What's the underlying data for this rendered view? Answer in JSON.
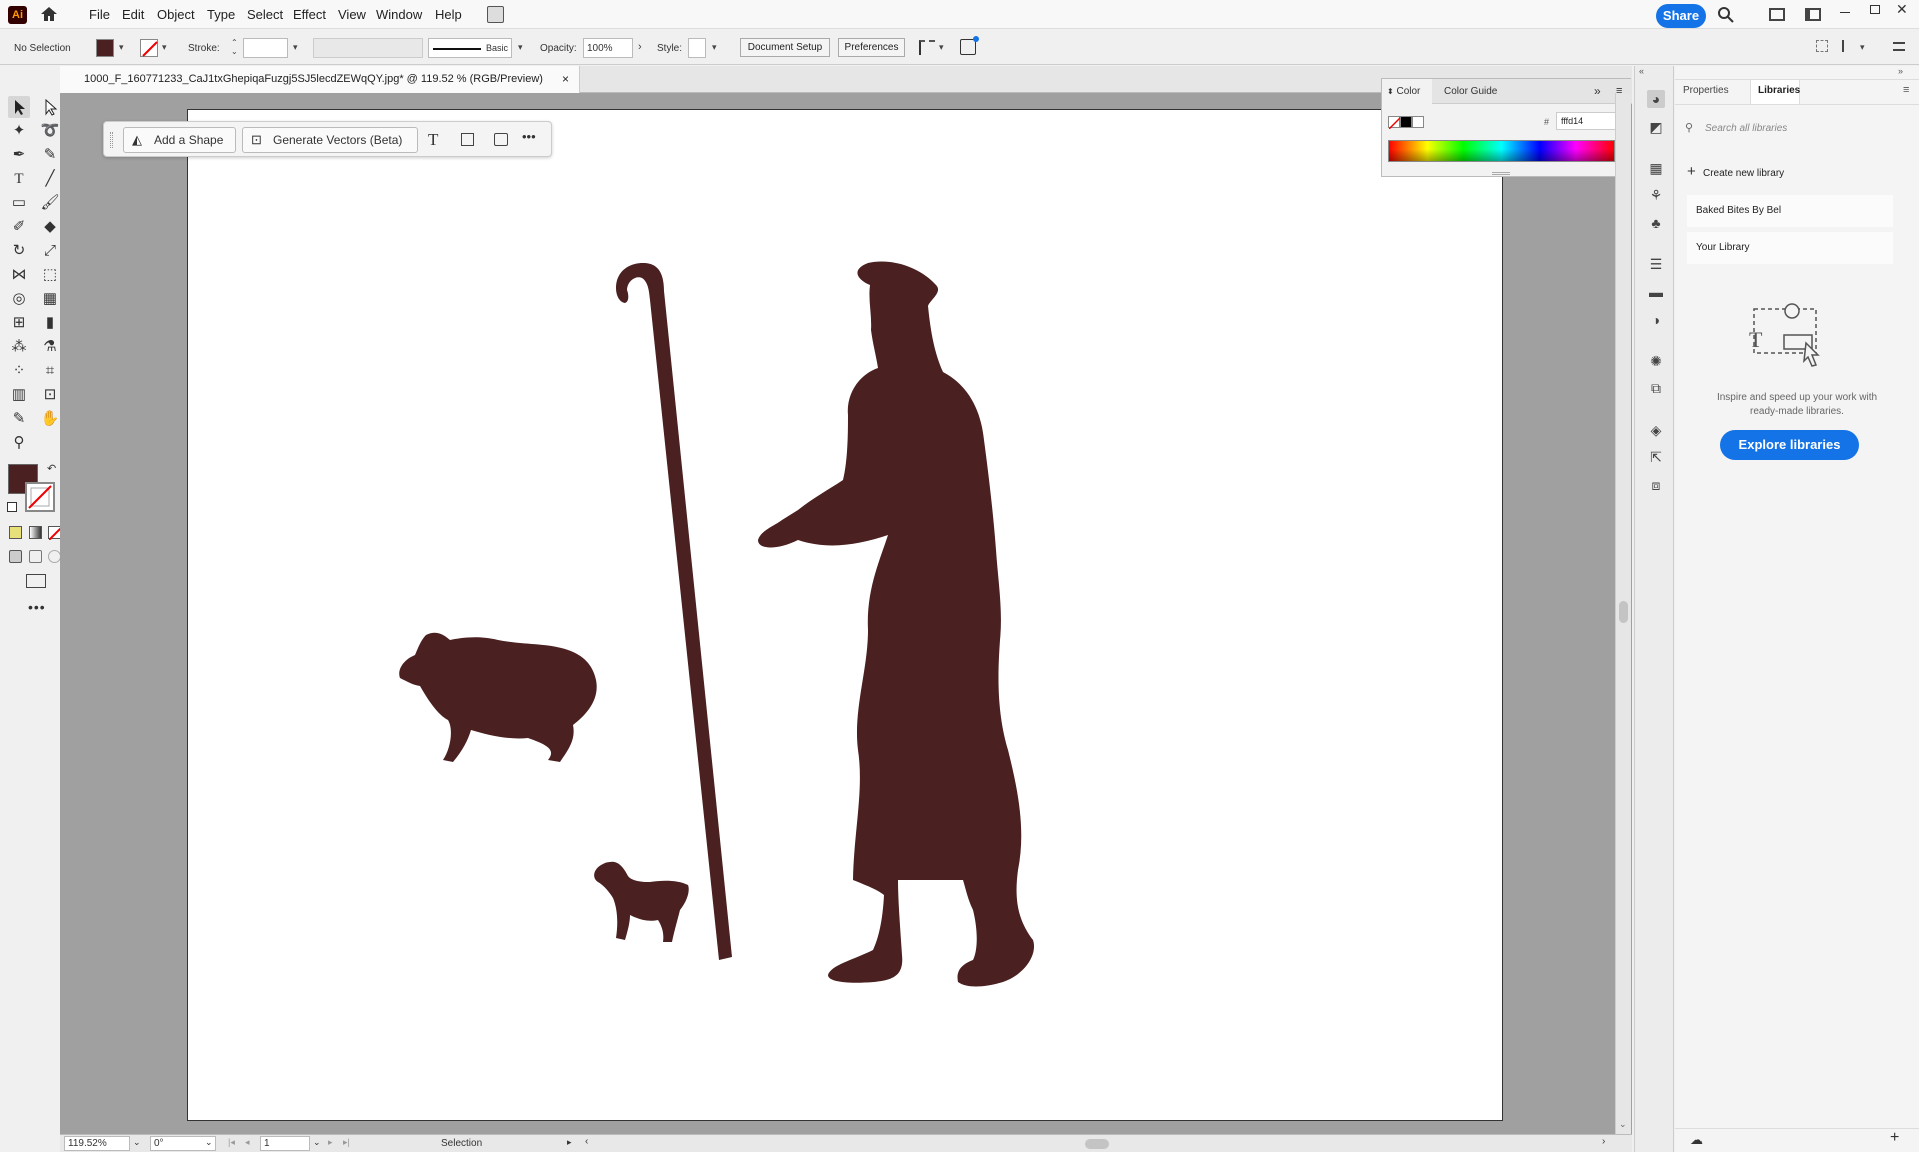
{
  "app": {
    "logo": "Ai"
  },
  "menu": [
    "File",
    "Edit",
    "Object",
    "Type",
    "Select",
    "Effect",
    "View",
    "Window",
    "Help"
  ],
  "share_label": "Share",
  "control_bar": {
    "selection": "No Selection",
    "stroke_label": "Stroke:",
    "brush": "Basic",
    "opacity_label": "Opacity:",
    "opacity": "100%",
    "style_label": "Style:",
    "doc_setup": "Document Setup",
    "preferences": "Preferences"
  },
  "doc_tab": {
    "title": "1000_F_160771233_CaJ1txGhepiqaFuzgj5SJ5lecdZEWqQY.jpg* @ 119.52 % (RGB/Preview)",
    "close": "×"
  },
  "context_bar": {
    "add_shape": "Add a Shape",
    "generate_vectors": "Generate Vectors (Beta)",
    "more": "•••"
  },
  "color_panel": {
    "tab_color": "Color",
    "tab_guide": "Color Guide",
    "hash": "#",
    "hex": "fffd14"
  },
  "right_panel": {
    "tab_properties": "Properties",
    "tab_libraries": "Libraries",
    "search_placeholder": "Search all libraries",
    "create_library": "Create new library",
    "libraries": [
      "Baked Bites By Bel",
      "Your Library"
    ],
    "promo_line1": "Inspire and speed up your work with",
    "promo_line2": "ready-made libraries.",
    "explore": "Explore libraries"
  },
  "status": {
    "zoom": "119.52%",
    "angle": "0°",
    "page": "1",
    "tool": "Selection"
  },
  "colors": {
    "fill": "#4a2020",
    "accent": "#1473e6"
  },
  "artwork": {
    "description_color": "#4a2020"
  }
}
